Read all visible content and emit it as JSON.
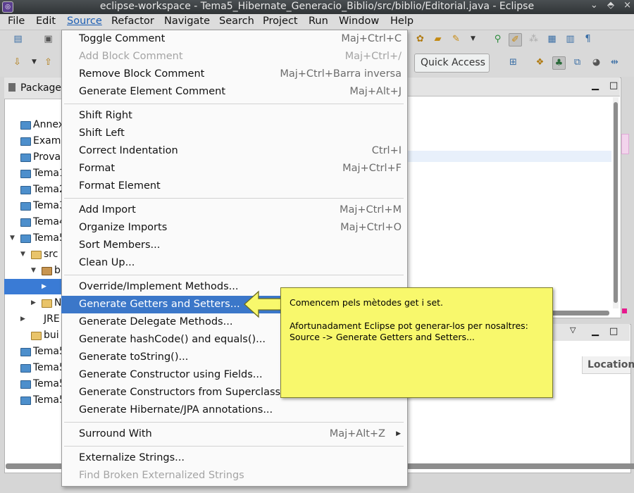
{
  "window": {
    "title": "eclipse-workspace - Tema5_Hibernate_Generacio_Biblio/src/biblio/Editorial.java - Eclipse",
    "controls": [
      "⌄",
      "⬘",
      "×"
    ]
  },
  "menubar": {
    "items": [
      "File",
      "Edit",
      "Source",
      "Refactor",
      "Navigate",
      "Search",
      "Project",
      "Run",
      "Window",
      "Help"
    ],
    "active": "Source"
  },
  "toolbar": {
    "quick_access": "Quick Access"
  },
  "package_explorer": {
    "tab_label": "Package",
    "rows": [
      {
        "twisty": "",
        "icon": "proj",
        "label": "Annex"
      },
      {
        "twisty": "",
        "icon": "proj",
        "label": "Exame"
      },
      {
        "twisty": "",
        "icon": "proj",
        "label": "Prova"
      },
      {
        "twisty": "",
        "icon": "proj",
        "label": "Tema1"
      },
      {
        "twisty": "",
        "icon": "proj",
        "label": "Tema2"
      },
      {
        "twisty": "",
        "icon": "proj",
        "label": "Tema3"
      },
      {
        "twisty": "",
        "icon": "proj",
        "label": "Tema4"
      },
      {
        "twisty": "▼",
        "icon": "proj",
        "label": "Tema5"
      },
      {
        "twisty": "▼",
        "icon": "folder",
        "label": "src"
      },
      {
        "twisty": "▼",
        "icon": "pkg",
        "label": "b"
      },
      {
        "twisty": "▶",
        "icon": "",
        "label": ""
      },
      {
        "twisty": "▶",
        "icon": "folder",
        "label": "N"
      },
      {
        "twisty": "▶",
        "icon": "",
        "label": "JRE"
      },
      {
        "twisty": "",
        "icon": "folder",
        "label": "bui"
      },
      {
        "twisty": "",
        "icon": "proj",
        "label": "Tema5"
      },
      {
        "twisty": "",
        "icon": "proj",
        "label": "Tema5"
      },
      {
        "twisty": "",
        "icon": "proj",
        "label": "Tema5"
      },
      {
        "twisty": "",
        "icon": "proj",
        "label": "Tema5"
      }
    ]
  },
  "lower_panel": {
    "location_header": "Location"
  },
  "source_menu": {
    "items": [
      {
        "label": "Toggle Comment",
        "shortcut": "Maj+Ctrl+C",
        "enabled": true
      },
      {
        "label": "Add Block Comment",
        "shortcut": "Maj+Ctrl+/",
        "enabled": false
      },
      {
        "label": "Remove Block Comment",
        "shortcut": "Maj+Ctrl+Barra inversa",
        "enabled": true
      },
      {
        "label": "Generate Element Comment",
        "shortcut": "Maj+Alt+J",
        "enabled": true
      },
      {
        "label": "Shift Right",
        "shortcut": "",
        "enabled": true
      },
      {
        "label": "Shift Left",
        "shortcut": "",
        "enabled": true
      },
      {
        "label": "Correct Indentation",
        "shortcut": "Ctrl+I",
        "enabled": true
      },
      {
        "label": "Format",
        "shortcut": "Maj+Ctrl+F",
        "enabled": true
      },
      {
        "label": "Format Element",
        "shortcut": "",
        "enabled": true
      },
      {
        "label": "Add Import",
        "shortcut": "Maj+Ctrl+M",
        "enabled": true
      },
      {
        "label": "Organize Imports",
        "shortcut": "Maj+Ctrl+O",
        "enabled": true
      },
      {
        "label": "Sort Members...",
        "shortcut": "",
        "enabled": true
      },
      {
        "label": "Clean Up...",
        "shortcut": "",
        "enabled": true
      },
      {
        "label": "Override/Implement Methods...",
        "shortcut": "",
        "enabled": true
      },
      {
        "label": "Generate Getters and Setters...",
        "shortcut": "",
        "enabled": true,
        "highlighted": true
      },
      {
        "label": "Generate Delegate Methods...",
        "shortcut": "",
        "enabled": true
      },
      {
        "label": "Generate hashCode() and equals()...",
        "shortcut": "",
        "enabled": true
      },
      {
        "label": "Generate toString()...",
        "shortcut": "",
        "enabled": true
      },
      {
        "label": "Generate Constructor using Fields...",
        "shortcut": "",
        "enabled": true
      },
      {
        "label": "Generate Constructors from Superclass...",
        "shortcut": "",
        "enabled": true
      },
      {
        "label": "Generate Hibernate/JPA annotations...",
        "shortcut": "",
        "enabled": true
      },
      {
        "label": "Surround With",
        "shortcut": "Maj+Alt+Z",
        "enabled": true,
        "submenu": true
      },
      {
        "label": "Externalize Strings...",
        "shortcut": "",
        "enabled": true
      },
      {
        "label": "Find Broken Externalized Strings",
        "shortcut": "",
        "enabled": false
      }
    ]
  },
  "callout": {
    "line1": "Comencem pels mètodes get i set.",
    "line2": "Afortunadament Eclipse pot generar-los per nosaltres:",
    "line3": "Source -> Generate Getters and Setters..."
  },
  "colors": {
    "selection": "#3b77c9",
    "callout_bg": "#f8f86c",
    "menu_active": "#1d5fb4"
  }
}
